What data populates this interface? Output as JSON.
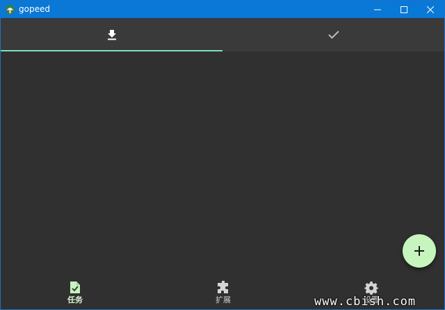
{
  "window": {
    "title": "gopeed",
    "icon": "gopeed-logo-icon",
    "controls": [
      "minimize-icon",
      "maximize-icon",
      "close-icon"
    ],
    "titlebar_color": "#0a78d7"
  },
  "tabs": [
    {
      "icon": "download-icon",
      "active": true
    },
    {
      "icon": "check-icon",
      "active": false
    }
  ],
  "accent": "#7ee0bf",
  "fab": {
    "icon": "plus-icon",
    "color": "#c6f6bd"
  },
  "bottom_nav": {
    "items": [
      {
        "label": "任务",
        "icon": "task-file-icon",
        "active": true
      },
      {
        "label": "扩展",
        "icon": "puzzle-icon",
        "active": false
      },
      {
        "label": "设置",
        "icon": "gear-icon",
        "active": false
      }
    ]
  },
  "watermark": "www.cbish.com"
}
